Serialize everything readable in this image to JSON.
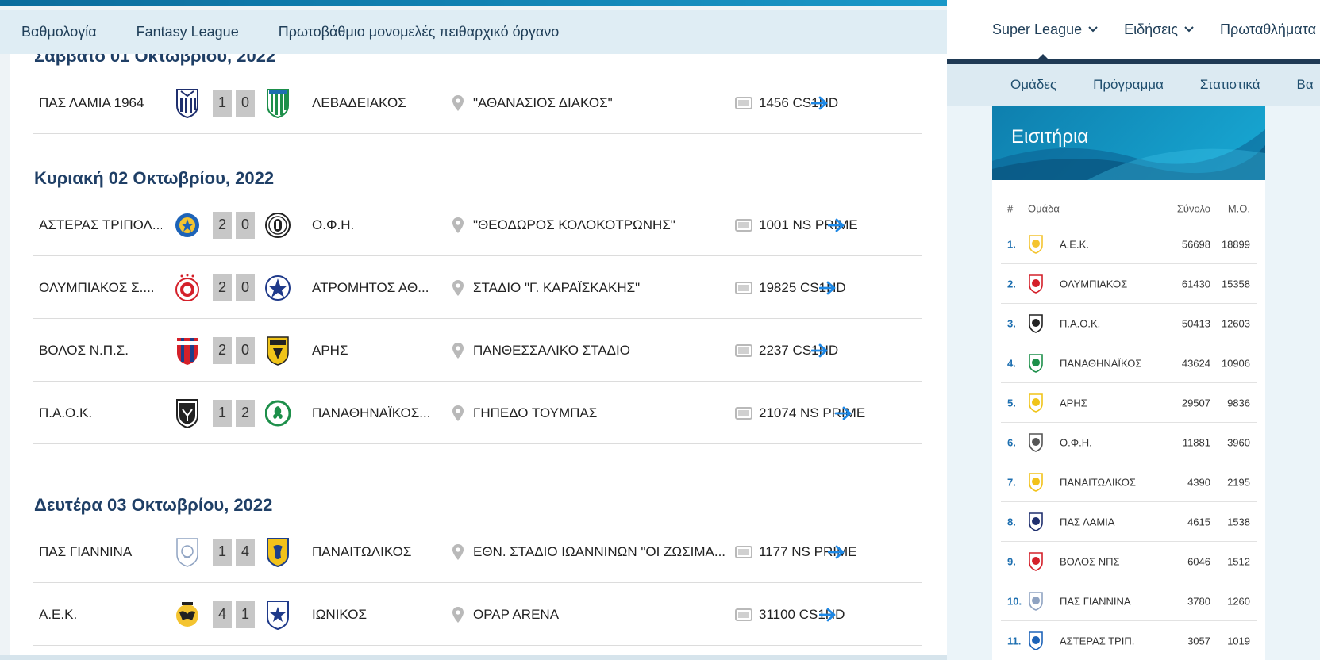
{
  "left": {
    "subnav": [
      "Βαθμολογία",
      "Fantasy League",
      "Πρωτοβάθμιο μονομελές πειθαρχικό όργανο"
    ],
    "days": [
      {
        "date": "Σάββατο 01 Οκτωβρίου, 2022",
        "matches": [
          {
            "home": "ΠΑΣ ΛΑΜΙΑ 1964",
            "home_score": "1",
            "away_score": "0",
            "away": "ΛΕΒΑΔΕΙΑΚΟΣ",
            "venue": "\"ΑΘΑΝΑΣΙΟΣ ΔΙΑΚΟΣ\"",
            "channel": "1456 CS1HD"
          }
        ]
      },
      {
        "date": "Κυριακή 02 Οκτωβρίου, 2022",
        "matches": [
          {
            "home": "ΑΣΤΕΡΑΣ ΤΡΙΠΟΛ...",
            "home_score": "2",
            "away_score": "0",
            "away": "Ο.Φ.Η.",
            "venue": "\"ΘΕΟΔΩΡΟΣ ΚΟΛΟΚΟΤΡΩΝΗΣ\"",
            "channel": "1001 NS PRIME"
          },
          {
            "home": "ΟΛΥΜΠΙΑΚΟΣ Σ....",
            "home_score": "2",
            "away_score": "0",
            "away": "ΑΤΡΟΜΗΤΟΣ ΑΘ...",
            "venue": "ΣΤΑΔΙΟ \"Γ. ΚΑΡΑΪΣΚΑΚΗΣ\"",
            "channel": "19825 CS1HD"
          },
          {
            "home": "ΒΟΛΟΣ Ν.Π.Σ.",
            "home_score": "2",
            "away_score": "0",
            "away": "ΑΡΗΣ",
            "venue": "ΠΑΝΘΕΣΣΑΛΙΚΟ ΣΤΑΔΙΟ",
            "channel": "2237 CS1HD"
          },
          {
            "home": "Π.Α.Ο.Κ.",
            "home_score": "1",
            "away_score": "2",
            "away": "ΠΑΝΑΘΗΝΑΪΚΟΣ...",
            "venue": "ΓΗΠΕΔΟ ΤΟΥΜΠΑΣ",
            "channel": "21074 NS PRIME"
          }
        ]
      },
      {
        "date": "Δευτέρα 03 Οκτωβρίου, 2022",
        "matches": [
          {
            "home": "ΠΑΣ ΓΙΑΝΝΙΝΑ",
            "home_score": "1",
            "away_score": "4",
            "away": "ΠΑΝΑΙΤΩΛΙΚΟΣ",
            "venue": "ΕΘΝ. ΣΤΑΔΙΟ ΙΩΑΝΝΙΝΩΝ \"ΟΙ ΖΩΣΙΜΑ...",
            "channel": "1177 NS PRIME"
          },
          {
            "home": "Α.Ε.Κ.",
            "home_score": "4",
            "away_score": "1",
            "away": "ΙΩΝΙΚΟΣ",
            "venue": "OPAP ARENA",
            "channel": "31100 CS1HD"
          }
        ]
      }
    ]
  },
  "right": {
    "topnav": [
      "Super League",
      "Ειδήσεις",
      "Πρωταθλήματα"
    ],
    "subnav": [
      "Ομάδες",
      "Πρόγραμμα",
      "Στατιστικά",
      "Βα"
    ],
    "tickets": {
      "title": "Εισιτήρια",
      "headers": {
        "rank": "#",
        "team": "Ομάδα",
        "total": "Σύνολο",
        "avg": "Μ.Ο."
      },
      "rows": [
        {
          "rank": "1.",
          "team": "Α.Ε.Κ.",
          "total": "56698",
          "avg": "18899"
        },
        {
          "rank": "2.",
          "team": "ΟΛΥΜΠΙΑΚΟΣ",
          "total": "61430",
          "avg": "15358"
        },
        {
          "rank": "3.",
          "team": "Π.Α.Ο.Κ.",
          "total": "50413",
          "avg": "12603"
        },
        {
          "rank": "4.",
          "team": "ΠΑΝΑΘΗΝΑΪΚΟΣ",
          "total": "43624",
          "avg": "10906"
        },
        {
          "rank": "5.",
          "team": "ΑΡΗΣ",
          "total": "29507",
          "avg": "9836"
        },
        {
          "rank": "6.",
          "team": "Ο.Φ.Η.",
          "total": "11881",
          "avg": "3960"
        },
        {
          "rank": "7.",
          "team": "ΠΑΝΑΙΤΩΛΙΚΟΣ",
          "total": "4390",
          "avg": "2195"
        },
        {
          "rank": "8.",
          "team": "ΠΑΣ ΛΑΜΙΑ",
          "total": "4615",
          "avg": "1538"
        },
        {
          "rank": "9.",
          "team": "ΒΟΛΟΣ ΝΠΣ",
          "total": "6046",
          "avg": "1512"
        },
        {
          "rank": "10.",
          "team": "ΠΑΣ ΓΙΑΝΝΙΝΑ",
          "total": "3780",
          "avg": "1260"
        },
        {
          "rank": "11.",
          "team": "ΑΣΤΕΡΑΣ ΤΡΙΠ.",
          "total": "3057",
          "avg": "1019"
        }
      ]
    }
  },
  "colors": {
    "heading": "#1f3f66",
    "link_arrow": "#1e88e5",
    "rank": "#1d6fb0",
    "score_bg": "#c7c7c7",
    "nav_bar": "#1f3a55"
  }
}
